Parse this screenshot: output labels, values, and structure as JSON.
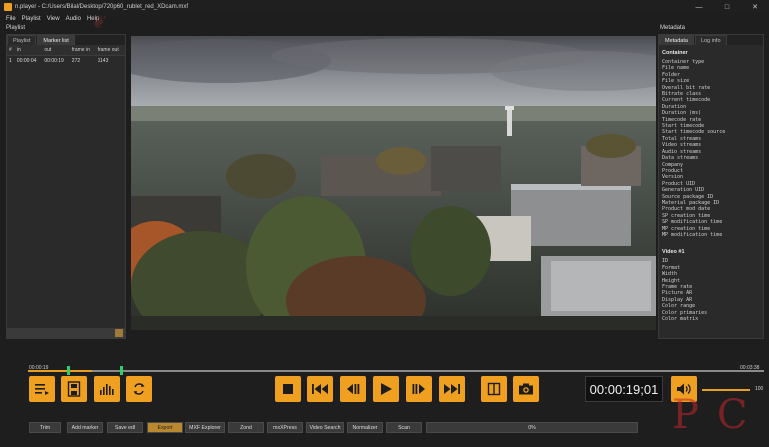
{
  "window": {
    "title": "n.player - C:/Users/Bilal/Desktop/720p60_rublet_red_XDcam.mxf",
    "controls": {
      "minimize": "—",
      "maximize": "□",
      "close": "✕"
    }
  },
  "menu": [
    "File",
    "Playlist",
    "View",
    "Audio",
    "Help"
  ],
  "playlist_panel": {
    "title": "Playlist",
    "tabs": [
      {
        "label": "Playlist",
        "active": false
      },
      {
        "label": "Marker list",
        "active": true
      }
    ],
    "columns": [
      "#",
      "in",
      "out",
      "frame in",
      "frame out"
    ],
    "rows": [
      [
        "1",
        "00:00:04",
        "00:00:19",
        "272",
        "1143"
      ]
    ]
  },
  "metadata_panel": {
    "title": "Metadata",
    "tabs": [
      {
        "label": "Metadata",
        "active": true
      },
      {
        "label": "Log info",
        "active": false
      }
    ],
    "sections": [
      {
        "heading": "Container",
        "items": [
          "Container type",
          "File name",
          "Folder",
          "File size",
          "Overall bit rate",
          "Bitrate class",
          "Current timecode",
          "Duration",
          "Duration (ms)",
          "Timecode rate",
          "Start timecode",
          "Start timecode source",
          "Total streams",
          "Video streams",
          "Audio streams",
          "Data streams",
          "Company",
          "Product",
          "Version",
          "Product UID",
          "Generation UID",
          "Source package ID",
          "Material package ID",
          "Product mod date",
          "SP creation time",
          "SP modification time",
          "MP creation time",
          "MP modification time"
        ]
      },
      {
        "heading": "Video #1",
        "items": [
          "ID",
          "Format",
          "Width",
          "Height",
          "Frame rate",
          "Picture AR",
          "Display AR",
          "Color range",
          "Color primaries",
          "Color matrix"
        ]
      }
    ]
  },
  "timeline": {
    "current": "00:00:19",
    "total": "00:03:38",
    "progress": 0.087
  },
  "icons": {
    "marker_list": "marker-list-icon",
    "save_frame": "save-icon",
    "audio_levels": "audio-levels-icon",
    "loop": "loop-icon",
    "stop": "stop-icon",
    "rewind": "rewind-icon",
    "step_back": "step-back-icon",
    "play": "play-icon",
    "step_forward": "step-forward-icon",
    "fast_forward": "fast-forward-icon",
    "compare": "compare-icon",
    "snapshot": "camera-icon",
    "volume": "volume-icon"
  },
  "timecode": "00:00:19;01",
  "volume": {
    "value": "100",
    "level": 1.0
  },
  "bottom_buttons": [
    {
      "label": "Trim",
      "active": false
    },
    {
      "label": "Add marker",
      "active": false
    },
    {
      "label": "Save edl",
      "active": false
    },
    {
      "label": "Export",
      "active": true
    },
    {
      "label": "MXF Explorer",
      "active": false
    },
    {
      "label": "Zond",
      "active": false
    },
    {
      "label": "mxXPress",
      "active": false
    },
    {
      "label": "Video Search",
      "active": false
    },
    {
      "label": "Normalizer",
      "active": false
    },
    {
      "label": "Scan",
      "active": false
    }
  ],
  "progress": {
    "label": "0%",
    "value": 0
  },
  "colors": {
    "accent": "#f0a020",
    "marker": "#2fd06a",
    "background": "#1e1e1e"
  }
}
